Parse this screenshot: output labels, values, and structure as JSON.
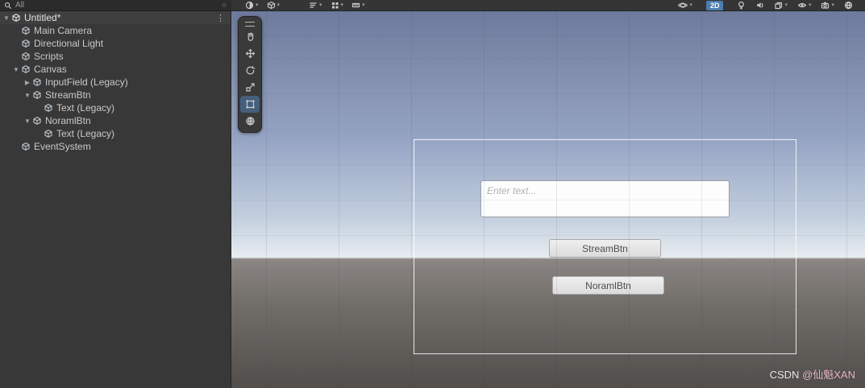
{
  "topbar": {
    "search_label": "All",
    "scene_toolbar": {
      "label_2d": "2D"
    }
  },
  "hierarchy": {
    "scene_title": "Untitled*",
    "items": [
      {
        "label": "Main Camera"
      },
      {
        "label": "Directional Light"
      },
      {
        "label": "Scripts"
      },
      {
        "label": "Canvas"
      },
      {
        "label": "InputField (Legacy)"
      },
      {
        "label": "StreamBtn"
      },
      {
        "label": "Text (Legacy)"
      },
      {
        "label": "NoramlBtn"
      },
      {
        "label": "Text (Legacy)"
      },
      {
        "label": "EventSystem"
      }
    ]
  },
  "tool_palette": {
    "selected_tool": "rect-tool"
  },
  "scene": {
    "canvas_ui": {
      "input_placeholder": "Enter text...",
      "stream_button_label": "StreamBtn",
      "normal_button_label": "NoramlBtn"
    },
    "watermark": {
      "prefix": "CSDN ",
      "user": "@仙魁XAN"
    }
  },
  "colors": {
    "panel_bg": "#383838",
    "selected_tool_accent": "#44607c",
    "active_2d_accent": "#4c7daf"
  }
}
